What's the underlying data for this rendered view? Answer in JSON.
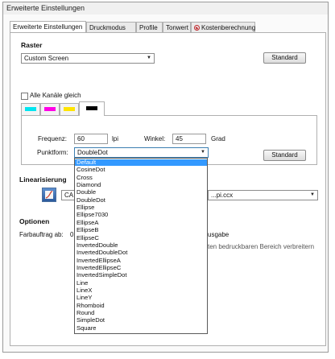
{
  "window": {
    "title": "Erweiterte Einstellungen"
  },
  "tabs": [
    {
      "label": "Erweiterte Einstellungen"
    },
    {
      "label": "Druckmodus"
    },
    {
      "label": "Profile"
    },
    {
      "label": "Tonwert"
    },
    {
      "label": "Kostenberechnung",
      "icon": "cancel-icon"
    }
  ],
  "raster": {
    "heading": "Raster",
    "combo_value": "Custom Screen",
    "standard_label": "Standard",
    "alle_kanaele_label": "Alle Kanäle gleich",
    "channel_colors": [
      "#00e5f0",
      "#ff00e6",
      "#ffe400",
      "#000000"
    ],
    "frequenz_label": "Frequenz:",
    "frequenz_value": "60",
    "frequenz_unit": "lpi",
    "winkel_label": "Winkel:",
    "winkel_value": "45",
    "winkel_unit": "Grad",
    "punktform_label": "Punktform:",
    "punktform_value": "DoubleDot",
    "standard2_label": "Standard"
  },
  "linearisierung": {
    "heading": "Linearisierung",
    "combo_left_value": "CA",
    "combo_right_value": "...pi.ccx"
  },
  "optionen": {
    "heading": "Optionen",
    "farbauftrag_label": "Farbauftrag ab:",
    "farbauftrag_value": "0",
    "partial_text_1": "usgabe",
    "partial_text_2": "ten bedruckbaren Bereich verbreitern"
  },
  "dropdown": {
    "selected": "Default",
    "items": [
      "Default",
      "CosineDot",
      "Cross",
      "Diamond",
      "Double",
      "DoubleDot",
      "Ellipse",
      "Ellipse7030",
      "EllipseA",
      "EllipseB",
      "EllipseC",
      "InvertedDouble",
      "InvertedDoubleDot",
      "InvertedEllipseA",
      "InvertedEllipseC",
      "InvertedSimpleDot",
      "Line",
      "LineX",
      "LineY",
      "Rhomboid",
      "Round",
      "SimpleDot",
      "Square"
    ]
  }
}
